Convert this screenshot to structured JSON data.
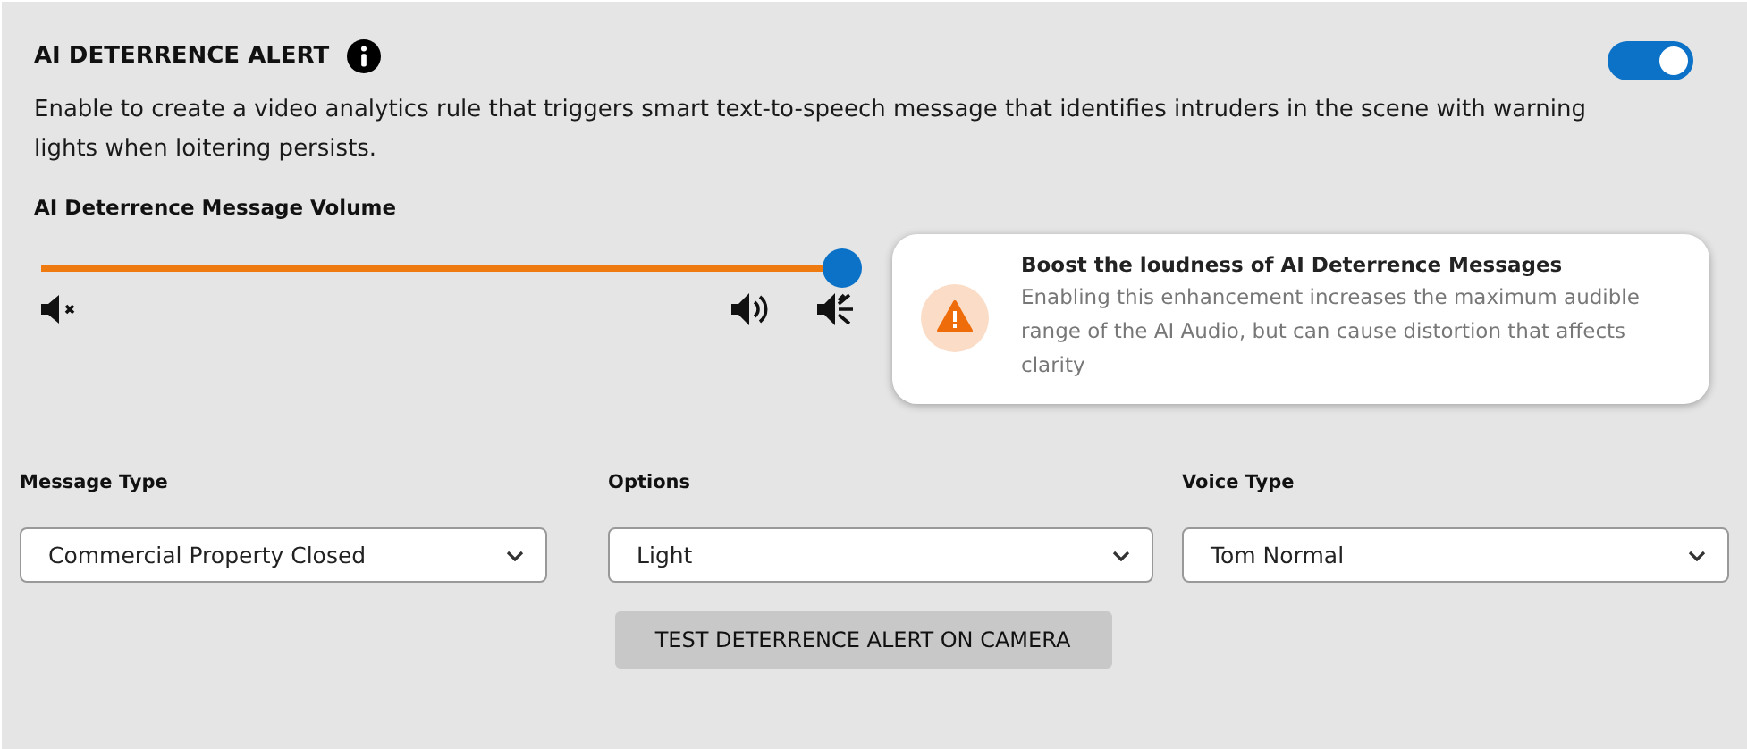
{
  "header": {
    "title": "AI DETERRENCE ALERT",
    "enabled": true
  },
  "description": "Enable to create a video analytics rule that triggers smart text-to-speech message that identifies intruders in the scene with warning lights when loitering persists.",
  "volume": {
    "label": "AI Deterrence Message Volume",
    "level": 1.0
  },
  "boost_card": {
    "title": "Boost the loudness of AI Deterrence Messages",
    "text": "Enabling this enhancement increases the maximum audible range of the AI Audio, but can cause distortion that affects clarity"
  },
  "dropdowns": [
    {
      "label": "Message Type",
      "value": "Commercial Property Closed"
    },
    {
      "label": "Options",
      "value": "Light"
    },
    {
      "label": "Voice Type",
      "value": "Tom Normal"
    }
  ],
  "test_button": "TEST DETERRENCE ALERT ON CAMERA"
}
